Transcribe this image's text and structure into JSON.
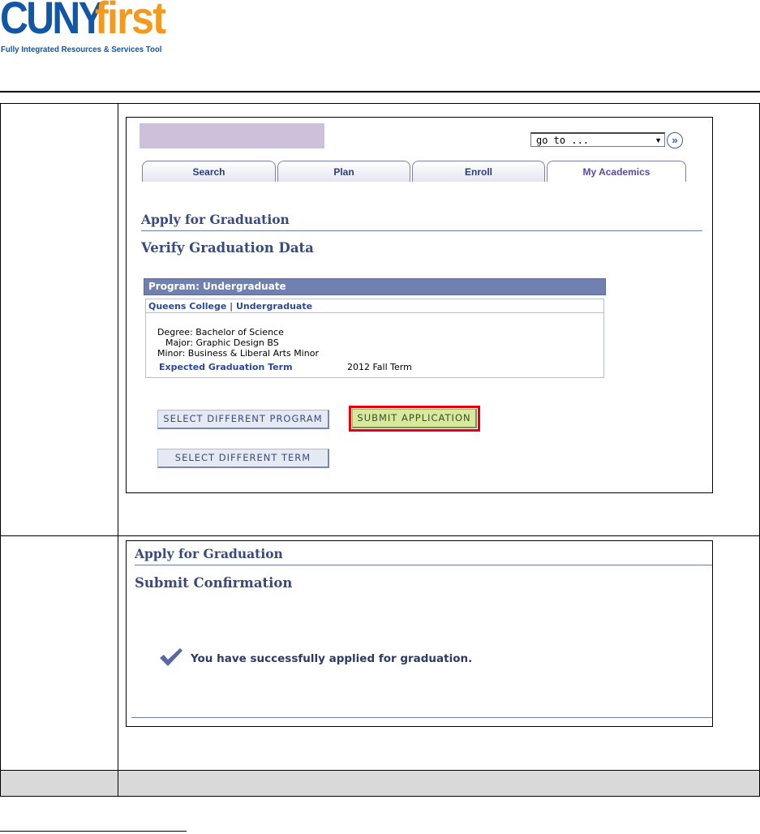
{
  "logo": {
    "cuny": "CUNY",
    "first": "first",
    "tagline": "Fully Integrated Resources & Services Tool"
  },
  "screen1": {
    "goto": {
      "value": "go to ..."
    },
    "tabs": [
      {
        "label": "Search"
      },
      {
        "label": "Plan"
      },
      {
        "label": "Enroll"
      },
      {
        "label": "My Academics"
      }
    ],
    "page_title": "Apply for Graduation",
    "section_title": "Verify Graduation Data",
    "program": {
      "header": "Program: Undergraduate",
      "institution": "Queens College | Undergraduate",
      "degree": "Degree: Bachelor of Science",
      "major": "Major: Graphic Design BS",
      "minor": "Minor: Business & Liberal Arts Minor",
      "expected_term_label": "Expected Graduation Term",
      "expected_term_value": "2012 Fall Term"
    },
    "buttons": {
      "select_program": "SELECT DIFFERENT PROGRAM",
      "submit": "SUBMIT APPLICATION",
      "select_term": "SELECT DIFFERENT TERM"
    }
  },
  "screen2": {
    "page_title": "Apply for Graduation",
    "section_title": "Submit Confirmation",
    "message": "You have successfully applied for graduation."
  },
  "colors": {
    "cuny_blue": "#1157a6",
    "first_orange": "#f39a1e",
    "header_purple": "#7080b0",
    "highlight_red": "#e4000f",
    "submit_green": "#d7ea9c"
  }
}
